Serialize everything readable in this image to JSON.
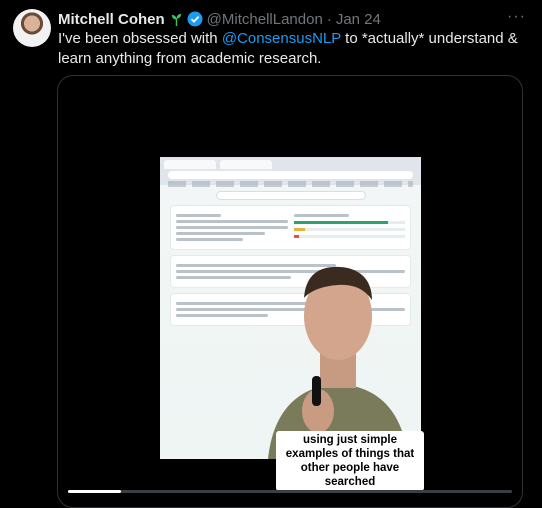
{
  "tweet": {
    "name": "Mitchell Cohen",
    "handle": "@MitchellLandon",
    "separator": "·",
    "date": "Jan 24",
    "text_before": "I've been obsessed with ",
    "mention": "@ConsensusNLP",
    "text_after": " to *actually* understand & learn anything from academic research.",
    "more_label": "···"
  },
  "video": {
    "caption": "using just simple examples of things that other people have searched",
    "progress": 0.12
  },
  "colors": {
    "accent": "#1d9bf0",
    "text": "#e7e9ea",
    "muted": "#71767b"
  }
}
